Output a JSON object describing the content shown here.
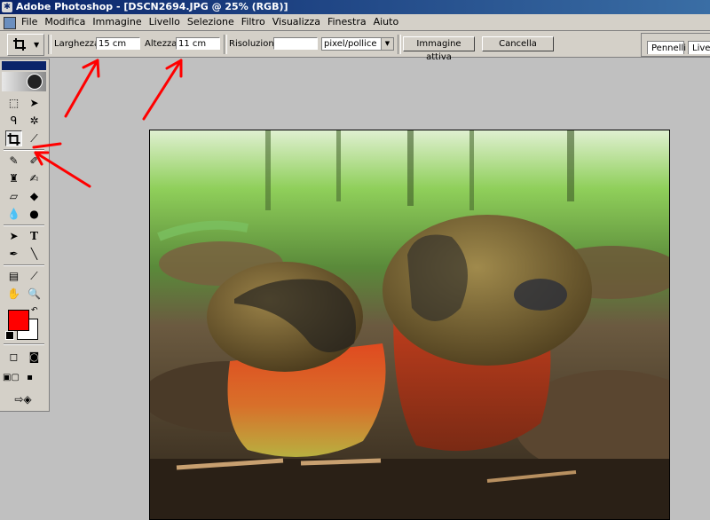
{
  "window": {
    "title": "Adobe Photoshop - [DSCN2694.JPG @ 25% (RGB)]"
  },
  "menu": {
    "items": [
      "File",
      "Modifica",
      "Immagine",
      "Livello",
      "Selezione",
      "Filtro",
      "Visualizza",
      "Finestra",
      "Aiuto"
    ]
  },
  "options": {
    "width_label": "Larghezza:",
    "width_value": "15 cm",
    "height_label": "Altezza:",
    "height_value": "11 cm",
    "resolution_label": "Risoluzione:",
    "resolution_value": "",
    "resolution_unit": "pixel/pollice",
    "front_image_button": "Immagine attiva",
    "clear_button": "Cancella"
  },
  "palette_well": {
    "tabs": [
      "Pennelli",
      "Live"
    ]
  },
  "toolbox": {
    "type_tool_glyph": "T",
    "foreground_color": "#ff0000",
    "background_color": "#ffffff"
  },
  "annotations": {
    "arrow_color": "#ff0000",
    "arrow_count": 4
  },
  "icons": [
    "crop-icon",
    "marquee-icon",
    "move-icon",
    "lasso-icon",
    "magic-wand-icon",
    "slice-icon",
    "healing-brush-icon",
    "brush-icon",
    "clone-stamp-icon",
    "history-brush-icon",
    "eraser-icon",
    "paint-bucket-icon",
    "blur-icon",
    "dodge-icon",
    "path-selection-icon",
    "pen-icon",
    "line-icon",
    "notes-icon",
    "eyedropper-icon",
    "hand-icon",
    "zoom-icon",
    "quick-mask-icon",
    "screen-mode-icon",
    "jump-to-imageready-icon"
  ]
}
